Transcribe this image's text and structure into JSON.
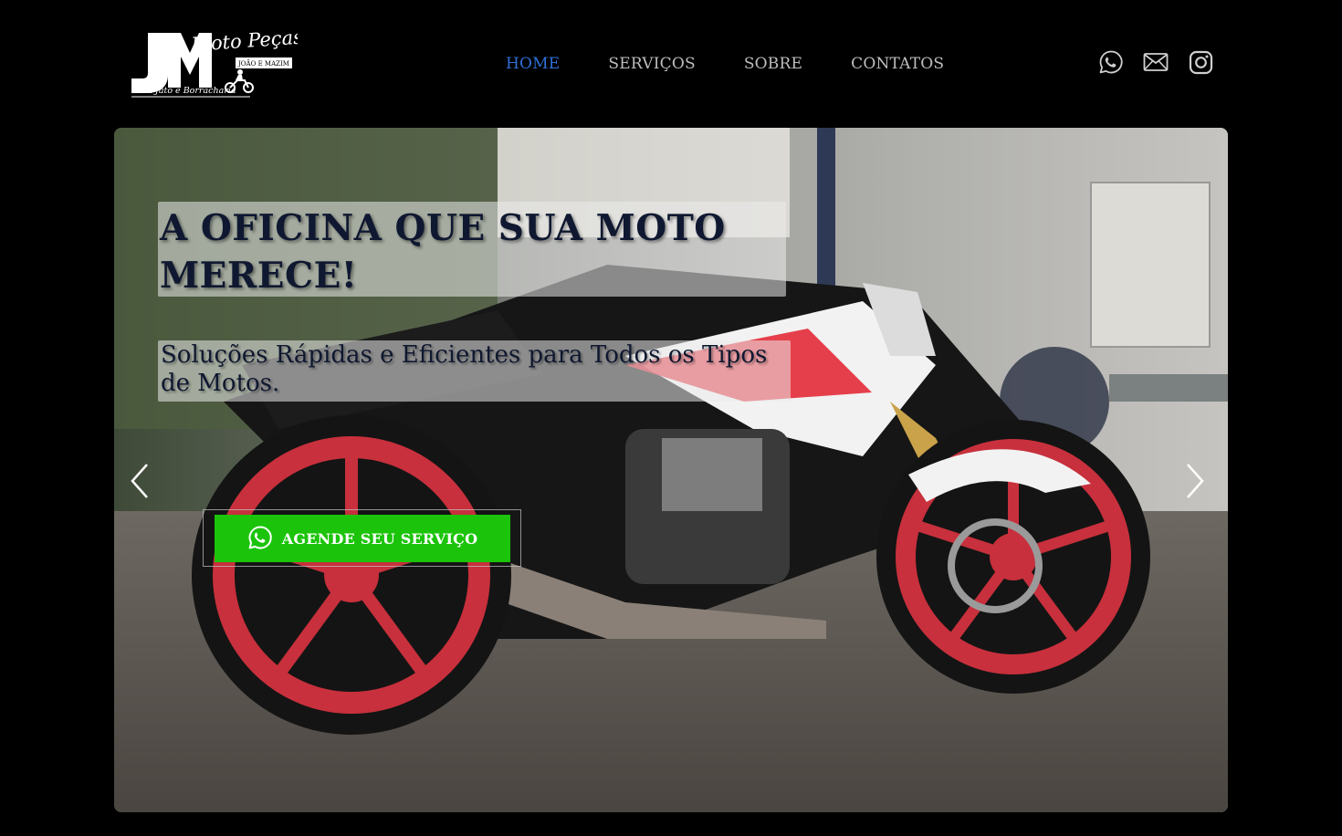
{
  "brand": {
    "logo_text_main": "JM",
    "logo_text_script": "Moto Peças",
    "logo_text_owners": "JOÃO E MAZIM",
    "logo_text_tagline": "Lava Jato e Borracharia"
  },
  "nav": {
    "items": [
      {
        "label": "HOME",
        "active": true
      },
      {
        "label": "SERVIÇOS",
        "active": false
      },
      {
        "label": "SOBRE",
        "active": false
      },
      {
        "label": "CONTATOS",
        "active": false
      }
    ],
    "active_color": "#2f6fd6",
    "inactive_color": "#bdbdbd"
  },
  "social": {
    "icons": [
      "whatsapp-icon",
      "email-icon",
      "instagram-icon"
    ]
  },
  "hero": {
    "headline": "A OFICINA QUE SUA MOTO MERECE!",
    "subtitle": "Soluções Rápidas e Eficientes para Todos os Tipos de Motos.",
    "cta_label": "AGENDE SEU SERVIÇO",
    "cta_color": "#1bc40a",
    "prev_icon": "chevron-left-icon",
    "next_icon": "chevron-right-icon",
    "image_subject": "Honda motorcycle, white with red wheels"
  },
  "colors": {
    "background": "#000000",
    "headline_text": "#0f1830"
  }
}
